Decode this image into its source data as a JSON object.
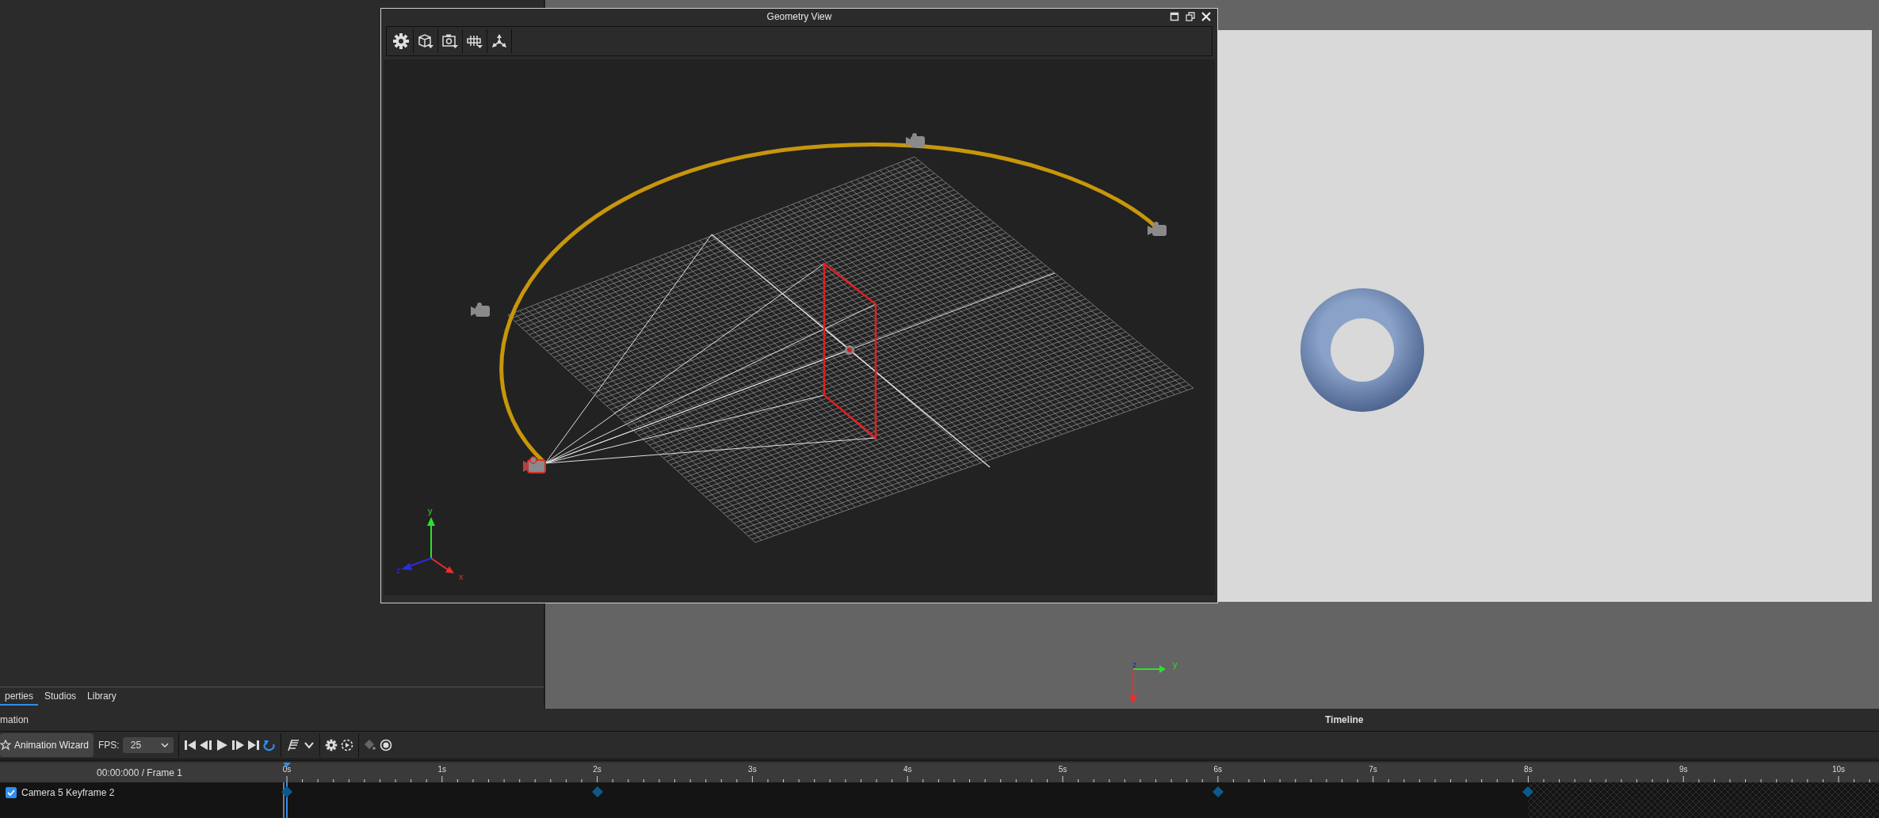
{
  "geometry_view": {
    "title": "Geometry View",
    "axis_labels": [
      "x",
      "y",
      "z"
    ]
  },
  "viewport_axis_labels": [
    "z",
    "y"
  ],
  "left_tabs": [
    {
      "label": "perties",
      "selected": true
    },
    {
      "label": "Studios",
      "selected": false
    },
    {
      "label": "Library",
      "selected": false
    }
  ],
  "animation_panel": {
    "title": "mation"
  },
  "timeline_panel": {
    "title": "Timeline"
  },
  "toolbar": {
    "wizard_button": "Animation Wizard",
    "fps_label": "FPS:",
    "fps_value": "25",
    "loop": true
  },
  "timeline": {
    "time_display": "00:00:000 / Frame 1",
    "ruler_labels": [
      "0s",
      "1s",
      "2s",
      "3s",
      "4s",
      "5s",
      "6s",
      "7s",
      "8s",
      "9s",
      "10s"
    ],
    "tracks": [
      {
        "name": "Camera 5 Keyframe 2",
        "checked": true,
        "keyframes": [
          true,
          false,
          true,
          false,
          false,
          false,
          true,
          false,
          true,
          false,
          false
        ]
      }
    ]
  }
}
